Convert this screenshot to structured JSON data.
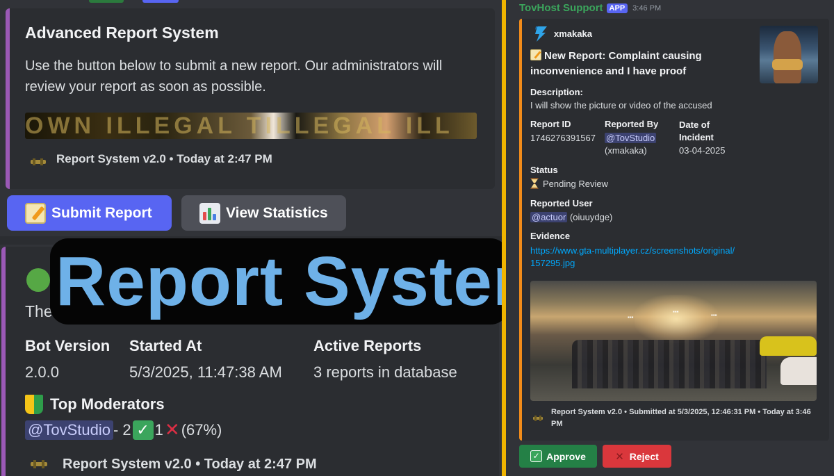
{
  "left": {
    "embed1": {
      "title": "Advanced Report System",
      "description": "Use the button below to submit a new report. Our administrators will review your report as soon as possible.",
      "banner_text": "OWN ILLEGAL  TILLEGAL ILL",
      "footer": "Report System v2.0 • Today at 2:47 PM"
    },
    "buttons": {
      "submit_label": "Submit Report",
      "stats_label": "View Statistics"
    },
    "embed2": {
      "partial_text": "The",
      "fields": [
        {
          "name": "Bot Version",
          "value": "2.0.0"
        },
        {
          "name": "Started At",
          "value": "5/3/2025, 11:47:38 AM"
        },
        {
          "name": "Active Reports",
          "value": "3 reports in database"
        }
      ],
      "moderators_title": "Top Moderators",
      "moderator_mention": "@TovStudio",
      "moderator_sep": " - 2",
      "moderator_count_x": "1",
      "moderator_pct": " (67%)",
      "footer": "Report System v2.0 • Today at 2:47 PM"
    },
    "overlay_title": "Report System"
  },
  "right": {
    "author": "TovHost Support",
    "app_badge": "APP",
    "time": "3:46 PM",
    "embed": {
      "author": "xmakaka",
      "title": "New Report: Complaint causing inconvenience and I have proof",
      "description_label": "Description:",
      "description": "I will show the picture or video of the accused",
      "report_id_label": "Report ID",
      "report_id": "1746276391567",
      "reported_by_label": "Reported By",
      "reported_by_mention": "@TovStudio",
      "reported_by_user": "(xmakaka)",
      "date_label": "Date of Incident",
      "date": "03-04-2025",
      "status_label": "Status",
      "status": "Pending Review",
      "reported_user_label": "Reported User",
      "reported_user_mention": "@actuor",
      "reported_user_name": "(oiuuydge)",
      "evidence_label": "Evidence",
      "evidence_link": "https://www.gta-multiplayer.cz/screenshots/original/157295.jpg",
      "footer": "Report System v2.0 • Submitted at 5/3/2025, 12:46:31 PM • Today at 3:46 PM"
    },
    "approve_label": "Approve",
    "reject_label": "Reject"
  },
  "colors": {
    "accent_purple": "#9b59b6",
    "accent_orange": "#f28c1a",
    "blurple": "#5865f2",
    "green": "#248046",
    "red": "#da373c",
    "overlay_blue": "#6eb1e8"
  }
}
